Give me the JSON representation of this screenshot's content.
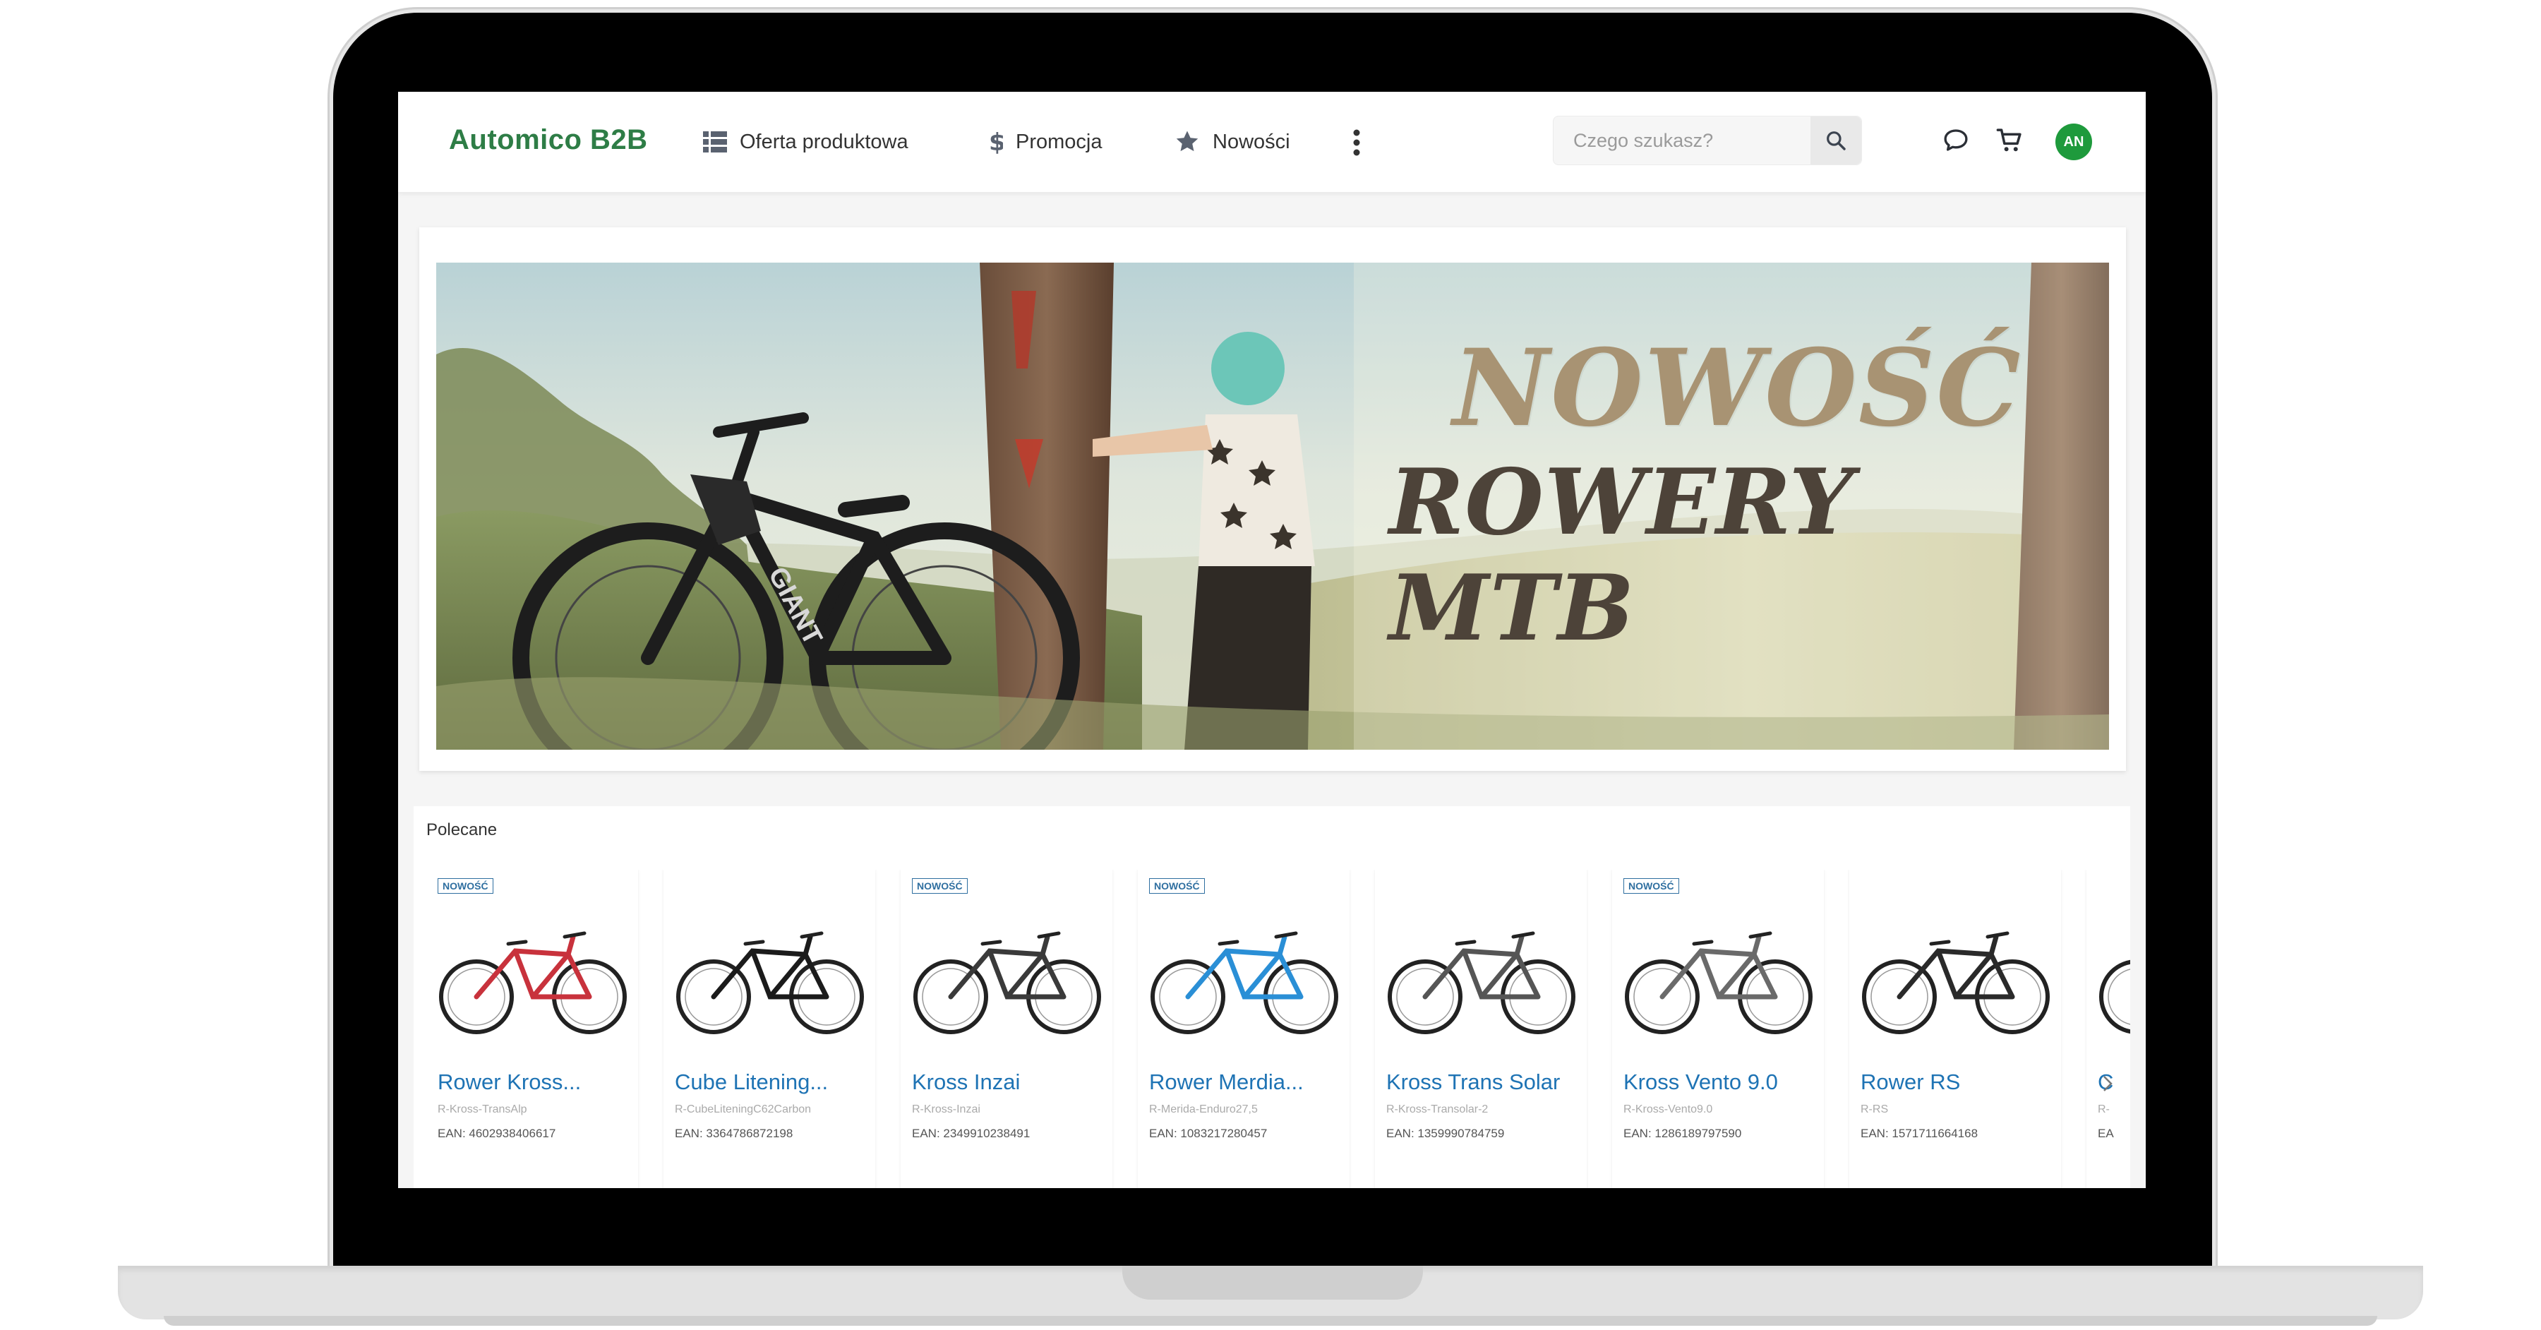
{
  "header": {
    "logo": "Automico B2B",
    "nav": [
      {
        "label": "Oferta produktowa",
        "icon": "grid-list-icon"
      },
      {
        "label": "Promocja",
        "icon": "dollar-icon"
      },
      {
        "label": "Nowości",
        "icon": "star-icon"
      }
    ],
    "search_placeholder": "Czego szukasz?",
    "avatar_initials": "AN"
  },
  "banner": {
    "title": "NOWOŚĆ",
    "subtitle": "ROWERY MTB"
  },
  "recommended": {
    "title": "Polecane",
    "products": [
      {
        "badge": "NOWOŚĆ",
        "name": "Rower Kross...",
        "sku": "R-Kross-TransAlp",
        "ean": "EAN: 4602938406617",
        "frame_color": "#c8323c"
      },
      {
        "badge": "",
        "name": "Cube Litening...",
        "sku": "R-CubeLiteningC62Carbon",
        "ean": "EAN: 3364786872198",
        "frame_color": "#1b1b1b"
      },
      {
        "badge": "NOWOŚĆ",
        "name": "Kross Inzai",
        "sku": "R-Kross-Inzai",
        "ean": "EAN: 2349910238491",
        "frame_color": "#3a3a3a"
      },
      {
        "badge": "NOWOŚĆ",
        "name": "Rower Merdia...",
        "sku": "R-Merida-Enduro27,5",
        "ean": "EAN: 1083217280457",
        "frame_color": "#2a8fd6"
      },
      {
        "badge": "",
        "name": "Kross Trans Solar",
        "sku": "R-Kross-Transolar-2",
        "ean": "EAN: 1359990784759",
        "frame_color": "#555555"
      },
      {
        "badge": "NOWOŚĆ",
        "name": "Kross Vento 9.0",
        "sku": "R-Kross-Vento9.0",
        "ean": "EAN: 1286189797590",
        "frame_color": "#6a6a6a"
      },
      {
        "badge": "",
        "name": "Rower RS",
        "sku": "R-RS",
        "ean": "EAN: 1571711664168",
        "frame_color": "#2a2a2a"
      },
      {
        "badge": "",
        "name": "C",
        "sku": "R-",
        "ean": "EA",
        "frame_color": "#2a2a2a"
      }
    ]
  },
  "colors": {
    "brand_green": "#2e7d46",
    "link_blue": "#1e73b4",
    "avatar_green": "#1e9a3c"
  }
}
